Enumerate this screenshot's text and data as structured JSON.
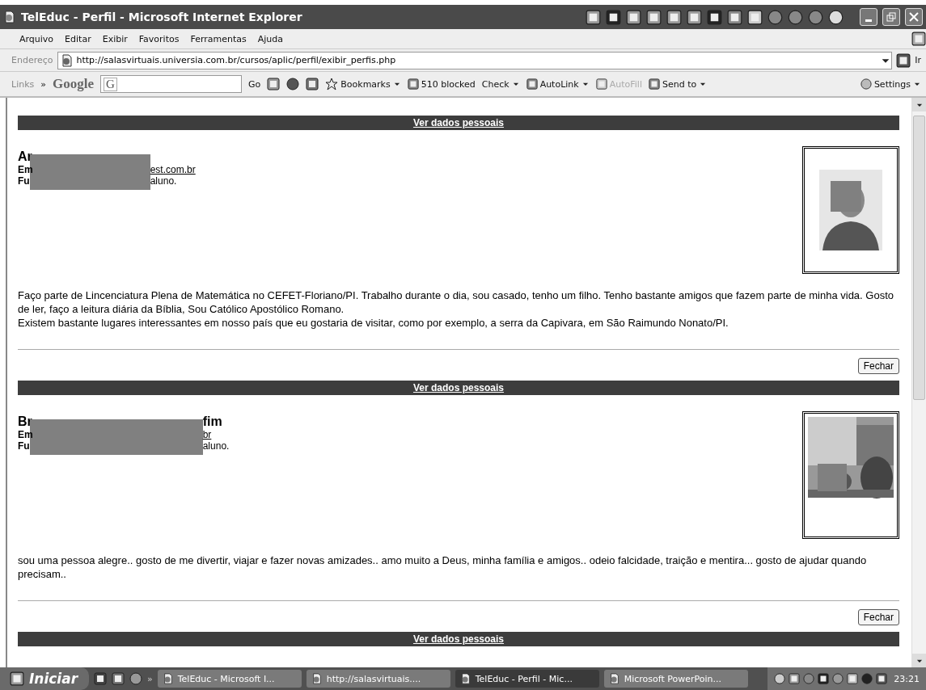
{
  "window": {
    "title": "TelEduc - Perfil - Microsoft Internet Explorer"
  },
  "menu": [
    "Arquivo",
    "Editar",
    "Exibir",
    "Favoritos",
    "Ferramentas",
    "Ajuda"
  ],
  "address": {
    "label": "Endereço",
    "url": "http://salasvirtuais.universia.com.br/cursos/aplic/perfil/exibir_perfis.php",
    "go": "Ir"
  },
  "links_bar": {
    "label": "Links",
    "chevron": "»",
    "google": "Google",
    "search_logo": "G",
    "go": "Go",
    "settings": "Settings",
    "items": [
      {
        "label": "Bookmarks",
        "kind": "menu",
        "disabled": false
      },
      {
        "label": "510 blocked",
        "kind": "plain",
        "disabled": false
      },
      {
        "label": "Check",
        "kind": "split",
        "disabled": false
      },
      {
        "label": "AutoLink",
        "kind": "split",
        "disabled": false
      },
      {
        "label": "AutoFill",
        "kind": "plain",
        "disabled": true
      },
      {
        "label": "Send to",
        "kind": "menu",
        "disabled": false
      }
    ]
  },
  "profiles": [
    {
      "link": "Ver dados pessoais",
      "name_start": "Ar",
      "email_label": "Em",
      "email": "est.com.br",
      "role_label": "Fu",
      "role": "aluno.",
      "about": [
        "Faço parte de Lincenciatura Plena de Matemática no CEFET-Floriano/PI. Trabalho durante o dia, sou casado, tenho um filho. Tenho bastante amigos que fazem parte de minha vida. Gosto de ler, faço a leitura diária da Bíblia, Sou Católico Apostólico Romano.",
        "Existem bastante lugares interessantes em nosso país que eu gostaria de visitar, como por exemplo, a serra da Capivara, em São Raimundo Nonato/PI."
      ],
      "close": "Fechar",
      "photo": {
        "kind": "portrait"
      }
    },
    {
      "link": "Ver dados pessoais",
      "name_start": "Br",
      "name_end": "fim",
      "email_label": "Em",
      "email": "br",
      "role_label": "Fu",
      "role": "aluno.",
      "about": [
        "sou uma pessoa alegre.. gosto de me divertir, viajar e fazer novas amizades.. amo muito a Deus, minha família e amigos.. odeio falcidade, traição e mentira... gosto de ajudar quando precisam.."
      ],
      "close": "Fechar",
      "photo": {
        "kind": "scene"
      }
    }
  ],
  "next_link": "Ver dados pessoais",
  "taskbar": {
    "start": "Iniciar",
    "chevron": "»",
    "clock": "23:21",
    "tasks": [
      {
        "label": "TelEduc - Microsoft I...",
        "selected": false
      },
      {
        "label": "http://salasvirtuais....",
        "selected": false
      },
      {
        "label": "TelEduc - Perfil - Mic...",
        "selected": true
      },
      {
        "label": "Microsoft PowerPoin...",
        "selected": false
      }
    ]
  }
}
